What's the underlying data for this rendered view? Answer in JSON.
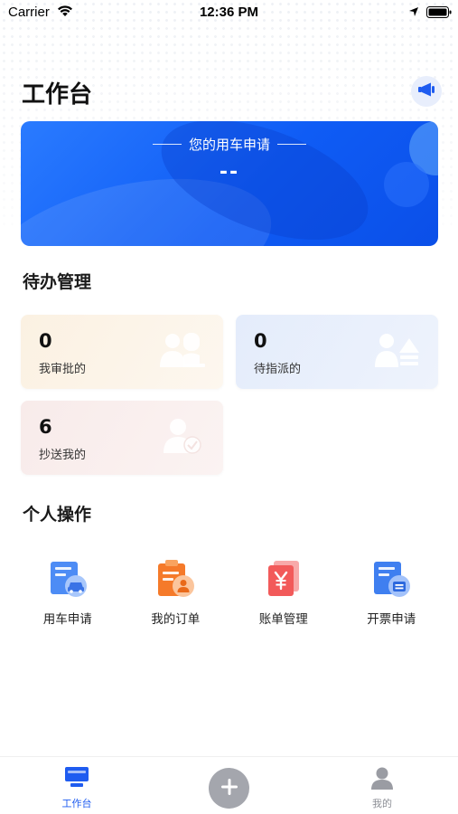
{
  "status_bar": {
    "carrier": "Carrier",
    "time": "12:36 PM"
  },
  "header": {
    "title": "工作台",
    "announce_icon": "megaphone-icon"
  },
  "banner": {
    "title": "您的用车申请",
    "value": "--"
  },
  "todo": {
    "section_title": "待办管理",
    "cards": [
      {
        "count": "0",
        "label": "我审批的",
        "icon": "approve-people-icon"
      },
      {
        "count": "0",
        "label": "待指派的",
        "icon": "assign-person-icon"
      },
      {
        "count": "6",
        "label": "抄送我的",
        "icon": "cc-person-icon"
      }
    ]
  },
  "personal": {
    "section_title": "个人操作",
    "actions": [
      {
        "label": "用车申请",
        "icon": "car-apply-icon",
        "color": "#4d8cf5"
      },
      {
        "label": "我的订单",
        "icon": "order-clipboard-icon",
        "color": "#f57a2a"
      },
      {
        "label": "账单管理",
        "icon": "bill-yen-icon",
        "color": "#f25a5a"
      },
      {
        "label": "开票申请",
        "icon": "invoice-icon",
        "color": "#3f7ff0"
      }
    ]
  },
  "tabbar": {
    "work_label": "工作台",
    "mine_label": "我的",
    "active_color": "#1f5cf0",
    "inactive_color": "#8d8f96"
  },
  "colors": {
    "banner_blue": "#0f5cf5",
    "add_button": "#a4a6ad"
  }
}
